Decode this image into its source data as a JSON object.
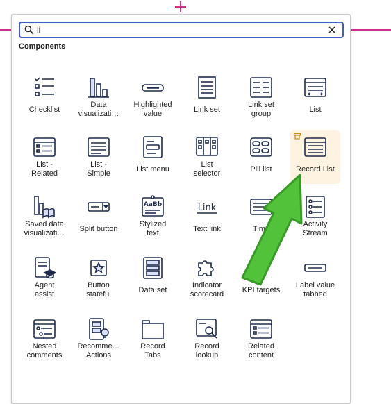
{
  "search": {
    "value": "li"
  },
  "section_title": "Components",
  "items": [
    {
      "line1": "Checklist",
      "line2": "",
      "icon": "checklist-icon"
    },
    {
      "line1": "Data",
      "line2": "visualizati…",
      "icon": "bar-chart-icon"
    },
    {
      "line1": "Highlighted",
      "line2": "value",
      "icon": "highlighted-value-icon"
    },
    {
      "line1": "Link set",
      "line2": "",
      "icon": "link-set-icon"
    },
    {
      "line1": "Link set",
      "line2": "group",
      "icon": "link-set-group-icon"
    },
    {
      "line1": "List",
      "line2": "",
      "icon": "list-icon"
    },
    {
      "line1": "List -",
      "line2": "Related",
      "icon": "list-related-icon"
    },
    {
      "line1": "List -",
      "line2": "Simple",
      "icon": "list-simple-icon"
    },
    {
      "line1": "List menu",
      "line2": "",
      "icon": "list-menu-icon"
    },
    {
      "line1": "List",
      "line2": "selector",
      "icon": "list-selector-icon"
    },
    {
      "line1": "Pill list",
      "line2": "",
      "icon": "pill-list-icon"
    },
    {
      "line1": "Record List",
      "line2": "",
      "icon": "record-list-icon"
    },
    {
      "line1": "Saved data",
      "line2": "visualizati…",
      "icon": "saved-data-visualization-icon"
    },
    {
      "line1": "Split button",
      "line2": "",
      "icon": "split-button-icon"
    },
    {
      "line1": "Stylized",
      "line2": "text",
      "icon": "stylized-text-icon"
    },
    {
      "line1": "Text link",
      "line2": "",
      "icon": "text-link-icon"
    },
    {
      "line1": "Time",
      "line2": "",
      "icon": "timeline-icon"
    },
    {
      "line1": "Activity",
      "line2": "Stream",
      "icon": "activity-stream-icon"
    },
    {
      "line1": "Agent",
      "line2": "assist",
      "icon": "agent-assist-icon"
    },
    {
      "line1": "Button",
      "line2": "stateful",
      "icon": "button-stateful-icon"
    },
    {
      "line1": "Data set",
      "line2": "",
      "icon": "data-set-icon"
    },
    {
      "line1": "Indicator",
      "line2": "scorecard",
      "icon": "indicator-scorecard-icon"
    },
    {
      "line1": "KPI targets",
      "line2": "",
      "icon": "kpi-targets-icon"
    },
    {
      "line1": "Label value",
      "line2": "tabbed",
      "icon": "label-value-tabbed-icon"
    },
    {
      "line1": "Nested",
      "line2": "comments",
      "icon": "nested-comments-icon"
    },
    {
      "line1": "Recomme…",
      "line2": "Actions",
      "icon": "recommended-actions-icon"
    },
    {
      "line1": "Record",
      "line2": "Tabs",
      "icon": "record-tabs-icon"
    },
    {
      "line1": "Record",
      "line2": "lookup",
      "icon": "record-lookup-icon"
    },
    {
      "line1": "Related",
      "line2": "content",
      "icon": "related-content-icon"
    }
  ],
  "colors": {
    "accent": "#3f5fc4",
    "icon": "#1f2b4d",
    "highlight": "#fdf3e0",
    "arrow": "#52c23a",
    "guide": "#d0308c"
  }
}
